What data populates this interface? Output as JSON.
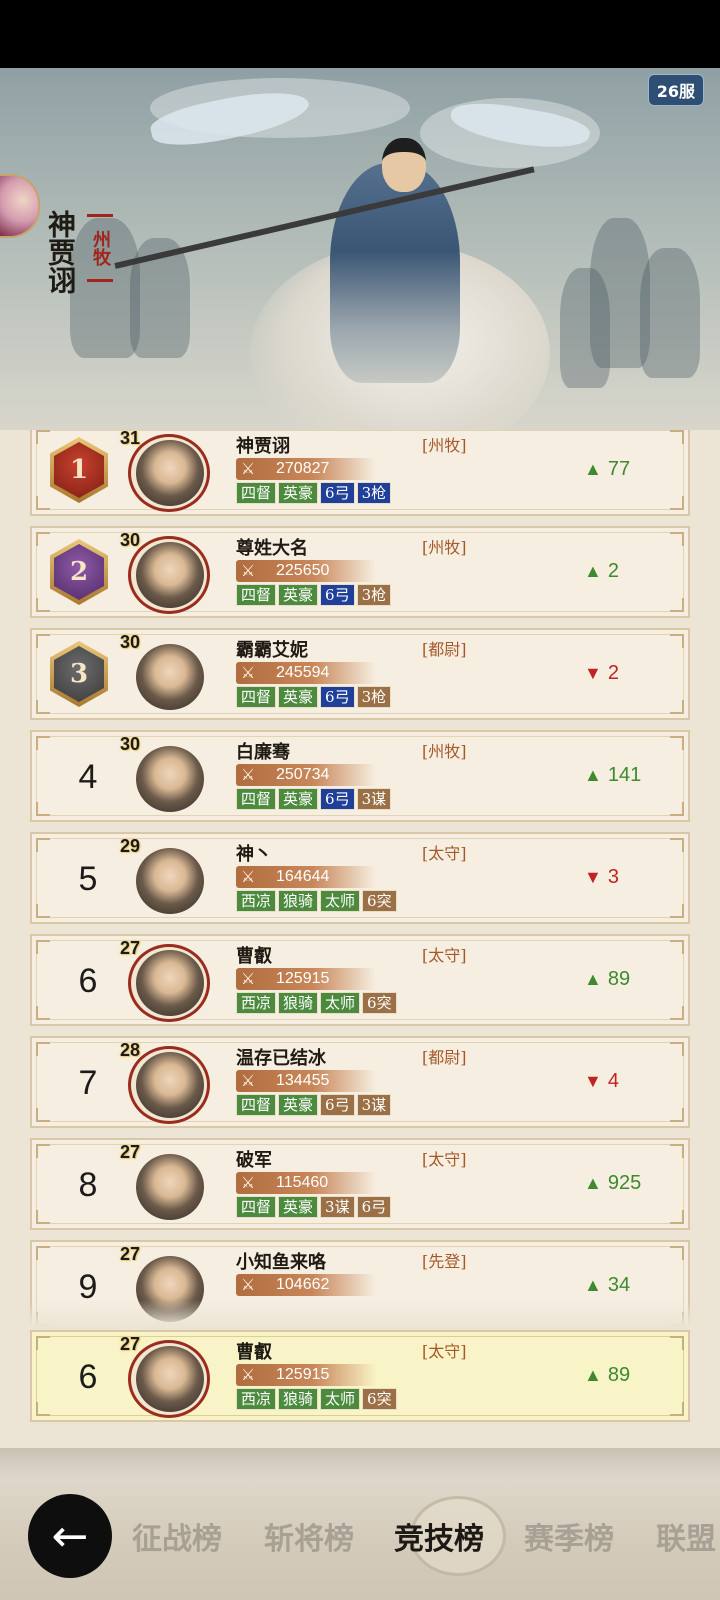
{
  "header": {
    "server_badge": "26服",
    "player_name": "神贾诩",
    "player_title": "州牧"
  },
  "leaderboard": [
    {
      "rank": "1",
      "level": "31",
      "name": "神贾诩",
      "title": "[州牧]",
      "power": "270827",
      "tags": [
        {
          "t": "四督",
          "c": "green"
        },
        {
          "t": "英豪",
          "c": "green"
        },
        {
          "t": "6弓",
          "c": "blue"
        },
        {
          "t": "3枪",
          "c": "blue"
        }
      ],
      "change_dir": "up",
      "change": "77",
      "ring": true
    },
    {
      "rank": "2",
      "level": "30",
      "name": "尊姓大名",
      "title": "[州牧]",
      "power": "225650",
      "tags": [
        {
          "t": "四督",
          "c": "green"
        },
        {
          "t": "英豪",
          "c": "green"
        },
        {
          "t": "6弓",
          "c": "blue"
        },
        {
          "t": "3枪",
          "c": "brown"
        }
      ],
      "change_dir": "up",
      "change": "2",
      "ring": true
    },
    {
      "rank": "3",
      "level": "30",
      "name": "霸霸艾妮",
      "title": "[都尉]",
      "power": "245594",
      "tags": [
        {
          "t": "四督",
          "c": "green"
        },
        {
          "t": "英豪",
          "c": "green"
        },
        {
          "t": "6弓",
          "c": "blue"
        },
        {
          "t": "3枪",
          "c": "brown"
        }
      ],
      "change_dir": "down",
      "change": "2",
      "ring": false
    },
    {
      "rank": "4",
      "level": "30",
      "name": "白廉骞",
      "title": "[州牧]",
      "power": "250734",
      "tags": [
        {
          "t": "四督",
          "c": "green"
        },
        {
          "t": "英豪",
          "c": "green"
        },
        {
          "t": "6弓",
          "c": "blue"
        },
        {
          "t": "3谋",
          "c": "brown"
        }
      ],
      "change_dir": "up",
      "change": "141",
      "ring": false
    },
    {
      "rank": "5",
      "level": "29",
      "name": "神丶",
      "title": "[太守]",
      "power": "164644",
      "tags": [
        {
          "t": "西凉",
          "c": "green"
        },
        {
          "t": "狼骑",
          "c": "green"
        },
        {
          "t": "太师",
          "c": "green"
        },
        {
          "t": "6突",
          "c": "brown"
        }
      ],
      "change_dir": "down",
      "change": "3",
      "ring": false
    },
    {
      "rank": "6",
      "level": "27",
      "name": "曹叡",
      "title": "[太守]",
      "power": "125915",
      "tags": [
        {
          "t": "西凉",
          "c": "green"
        },
        {
          "t": "狼骑",
          "c": "green"
        },
        {
          "t": "太师",
          "c": "green"
        },
        {
          "t": "6突",
          "c": "brown"
        }
      ],
      "change_dir": "up",
      "change": "89",
      "ring": true
    },
    {
      "rank": "7",
      "level": "28",
      "name": "温存已结冰",
      "title": "[都尉]",
      "power": "134455",
      "tags": [
        {
          "t": "四督",
          "c": "green"
        },
        {
          "t": "英豪",
          "c": "green"
        },
        {
          "t": "6弓",
          "c": "brown"
        },
        {
          "t": "3谋",
          "c": "brown"
        }
      ],
      "change_dir": "down",
      "change": "4",
      "ring": true
    },
    {
      "rank": "8",
      "level": "27",
      "name": "破军",
      "title": "[太守]",
      "power": "115460",
      "tags": [
        {
          "t": "四督",
          "c": "green"
        },
        {
          "t": "英豪",
          "c": "green"
        },
        {
          "t": "3谋",
          "c": "brown"
        },
        {
          "t": "6弓",
          "c": "brown"
        }
      ],
      "change_dir": "up",
      "change": "925",
      "ring": false
    },
    {
      "rank": "9",
      "level": "27",
      "name": "小知鱼来咯",
      "title": "[先登]",
      "power": "104662",
      "tags": [],
      "change_dir": "up",
      "change": "34",
      "ring": false
    }
  ],
  "self_row": {
    "rank": "6",
    "level": "27",
    "name": "曹叡",
    "title": "[太守]",
    "power": "125915",
    "tags": [
      {
        "t": "西凉",
        "c": "green"
      },
      {
        "t": "狼骑",
        "c": "green"
      },
      {
        "t": "太师",
        "c": "green"
      },
      {
        "t": "6突",
        "c": "brown"
      }
    ],
    "change_dir": "up",
    "change": "89",
    "ring": true
  },
  "nav": {
    "back_icon": "back-arrow-icon",
    "tabs": [
      {
        "label": "征战榜",
        "active": false
      },
      {
        "label": "斩将榜",
        "active": false
      },
      {
        "label": "竞技榜",
        "active": true
      },
      {
        "label": "赛季榜",
        "active": false
      },
      {
        "label": "联盟",
        "active": false
      }
    ]
  },
  "colors": {
    "up": "#3e8a2e",
    "down": "#c22222",
    "rank1": "#b0321f",
    "rank2": "#6a3d86",
    "rank3": "#505050"
  }
}
